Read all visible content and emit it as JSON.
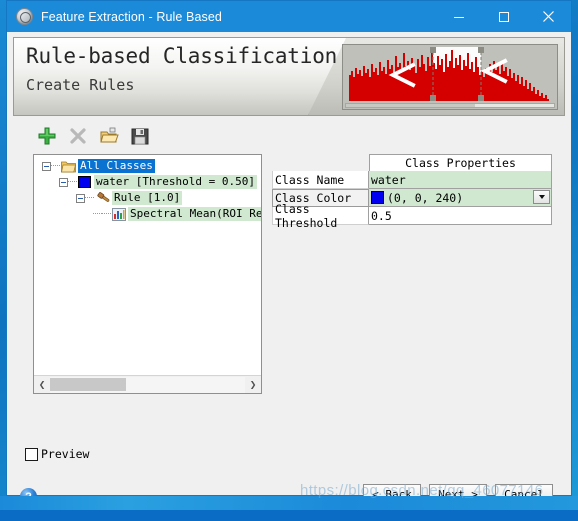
{
  "window": {
    "title": "Feature Extraction - Rule Based",
    "app_icon": "envi-logo-icon",
    "controls": {
      "minimize": "minimize-icon",
      "maximize": "maximize-icon",
      "close": "close-icon"
    }
  },
  "banner": {
    "title": "Rule-based Classification",
    "subtitle": "Create Rules",
    "graphic": "histogram-threshold-preview"
  },
  "toolbar": {
    "items": [
      {
        "icon": "add-icon",
        "name": "add-class-button",
        "enabled": true
      },
      {
        "icon": "delete-icon",
        "name": "delete-class-button",
        "enabled": false
      },
      {
        "icon": "open-folder-icon",
        "name": "open-rules-button",
        "enabled": true
      },
      {
        "icon": "save-disk-icon",
        "name": "save-rules-button",
        "enabled": true
      }
    ]
  },
  "tree": {
    "nodes": [
      {
        "label": "All Classes",
        "icon": "folder-icon",
        "highlight": "blue",
        "expanded": true,
        "depth": 0
      },
      {
        "label": "water [Threshold = 0.50]",
        "icon": "color-swatch-icon",
        "highlight": "green",
        "expanded": true,
        "depth": 1
      },
      {
        "label": "Rule [1.0]",
        "icon": "gavel-icon",
        "highlight": "green",
        "expanded": true,
        "depth": 2
      },
      {
        "label": "Spectral Mean(ROI Res",
        "icon": "chart-icon",
        "highlight": "green",
        "expanded": false,
        "depth": 3
      }
    ],
    "scrollbar": {
      "left_arrow": "❮",
      "right_arrow": "❯"
    }
  },
  "properties": {
    "header": "Class Properties",
    "rows": [
      {
        "label": "Class Name",
        "value": "water",
        "style": "green"
      },
      {
        "label": "Class Color",
        "value": "(0, 0, 240)",
        "style": "green",
        "swatch": "#0000f0",
        "dropdown": true,
        "selected": true
      },
      {
        "label": "Class Threshold",
        "value": "0.5",
        "style": "white"
      }
    ]
  },
  "preview": {
    "label": "Preview",
    "checked": false
  },
  "footer": {
    "help": "?",
    "buttons": [
      {
        "label": "< Back",
        "name": "back-button"
      },
      {
        "label": "Next >",
        "name": "next-button"
      },
      {
        "label": "Cancel",
        "name": "cancel-button"
      }
    ]
  },
  "watermark": "https://blog.csdn.net/qq_46077146",
  "colors": {
    "titlebar": "#1b8ad9",
    "selection_blue": "#0a72d0",
    "row_green": "#cfe8cf",
    "class_color": "#0000f0",
    "histogram_red": "#d40000"
  }
}
